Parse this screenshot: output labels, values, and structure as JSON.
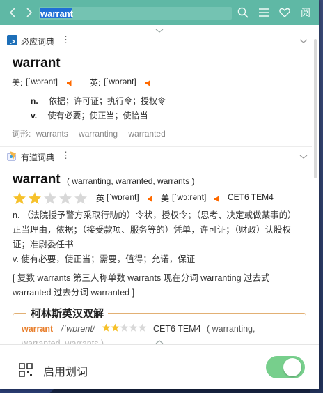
{
  "toolbar": {
    "search_value": "warrant",
    "colors": {
      "bar": "#5fb8a5",
      "accent": "#ff6a00",
      "star_on": "#f6c12b",
      "star_off": "#d8d8d8",
      "toggle": "#77cf8c"
    },
    "icons": [
      "back-arrow-icon",
      "forward-arrow-icon",
      "search-icon",
      "menu-icon",
      "favorite-heart-icon",
      "read-mode-icon"
    ],
    "read_label": "阅"
  },
  "bing": {
    "name": "必应词典",
    "more": "⋮",
    "word": "warrant",
    "us_label": "美:",
    "us_ph": "[ˈwɔrənt]",
    "uk_label": "英:",
    "uk_ph": "[ˈwɒrənt]",
    "defs": [
      {
        "pos": "n.",
        "text": "依据；许可证；执行令；授权令"
      },
      {
        "pos": "v.",
        "text": "使有必要；使正当；使恰当"
      }
    ],
    "forms_label": "词形:",
    "forms": [
      "warrants",
      "warranting",
      "warranted"
    ]
  },
  "youdao": {
    "name": "有道词典",
    "more": "⋮",
    "word": "warrant",
    "inflections": "( warranting, warranted, warrants )",
    "stars": 2,
    "stars_total": 5,
    "uk_label": "英",
    "uk_ph": "[ˈwɒrənt]",
    "us_label": "美",
    "us_ph": "[ˈwɔːrənt]",
    "exam": "CET6 TEM4",
    "def_n": "n. （法院授予警方采取行动的）令状，授权令；（思考、决定或做某事的）正当理由，依据；（接受款项、服务等的）凭单，许可证；（财政）认股权证；准尉委任书",
    "def_v": "v. 使有必要，使正当；需要，值得；允诺，保证",
    "forms_note": "[ 复数 warrants 第三人称单数 warrants 现在分词 warranting 过去式 warranted 过去分词 warranted ]"
  },
  "collins": {
    "title": "柯林斯英汉双解",
    "word": "warrant",
    "ph": "/ˈwɒrənt/",
    "stars": 2,
    "stars_total": 5,
    "exam": "CET6 TEM4",
    "inflections": "( warranting,",
    "inflections2": "warranted, warrants )"
  },
  "footer": {
    "label": "启用划词",
    "toggle_on": true
  }
}
